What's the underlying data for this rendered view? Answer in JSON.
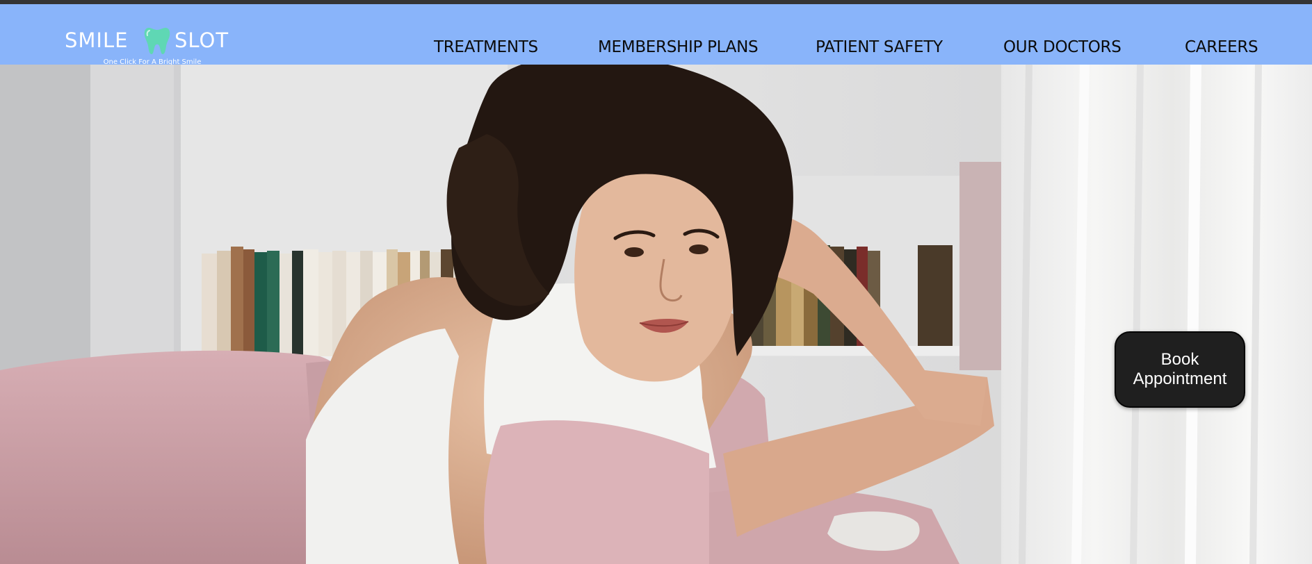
{
  "header": {
    "logo": {
      "left_word": "SMILE",
      "right_word": "SLOT",
      "tagline": "One Click For A Bright Smile",
      "icon": "tooth-icon",
      "icon_color": "#5fd7b4"
    },
    "nav": {
      "treatments": "TREATMENTS",
      "membership_plans": "MEMBERSHIP PLANS",
      "patient_safety": "PATIENT SAFETY",
      "our_doctors": "OUR DOCTORS",
      "careers": "CAREERS"
    },
    "background_color": "#89b4fa"
  },
  "hero": {
    "image": "woman-on-pink-couch-photo",
    "cta_label": "Book Appointment"
  }
}
